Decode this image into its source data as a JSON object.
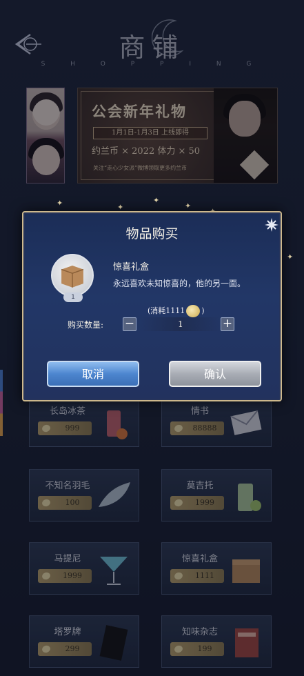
{
  "header": {
    "title": "商铺",
    "subtitle": "S H O P P I N G",
    "back_icon": "back-arrow-icon"
  },
  "banner": {
    "title": "公会新年礼物",
    "date": "1月1日-1月3日 上线即得",
    "rewards_line": "约兰币 × 2022    体力 × 50",
    "note": "关注“走心少女派”微博领取更多约兰币"
  },
  "shop": {
    "items": [
      {
        "name": "长岛冰茶",
        "price": "999"
      },
      {
        "name": "情书",
        "price": "88888"
      },
      {
        "name": "不知名羽毛",
        "price": "100"
      },
      {
        "name": "莫吉托",
        "price": "1999"
      },
      {
        "name": "马提尼",
        "price": "1999"
      },
      {
        "name": "惊喜礼盒",
        "price": "1111"
      },
      {
        "name": "塔罗牌",
        "price": "299"
      },
      {
        "name": "知味杂志",
        "price": "199"
      }
    ]
  },
  "modal": {
    "title": "物品购买",
    "item_name": "惊喜礼盒",
    "item_desc": "永远喜欢未知惊喜的，他的另一面。",
    "item_count": "1",
    "cost_prefix": "(消耗1111",
    "cost_suffix": ")",
    "qty_label": "购买数量:",
    "qty_value": "1",
    "minus_label": "−",
    "plus_label": "+",
    "cancel_label": "取消",
    "confirm_label": "确认",
    "colors": {
      "confirm": "#a9adb5",
      "cancel": "#4d86cf",
      "border": "#cdb88c"
    }
  }
}
